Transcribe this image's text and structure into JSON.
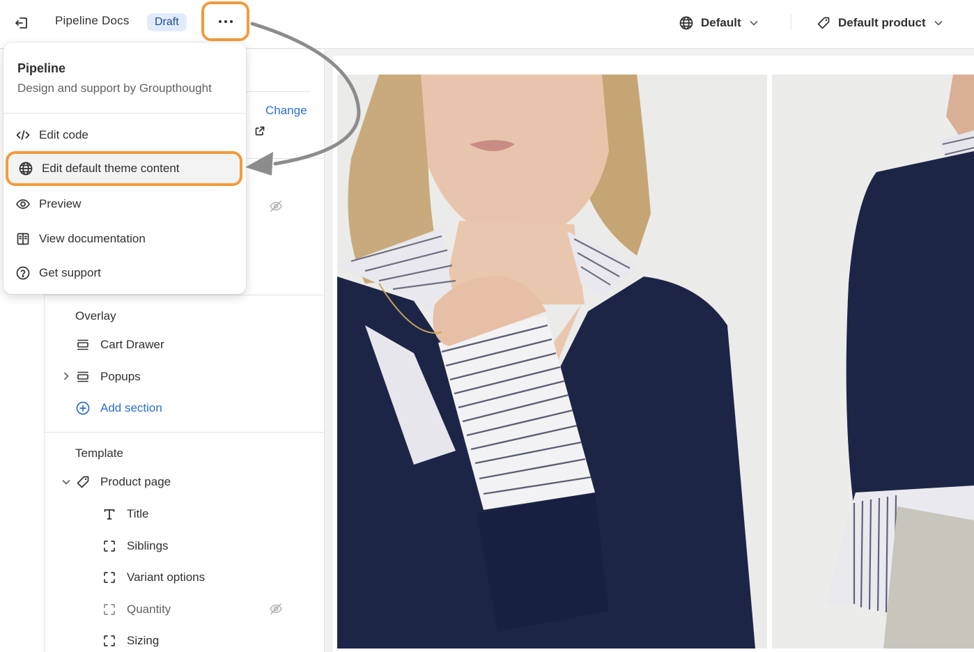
{
  "topbar": {
    "theme_name": "Pipeline Docs",
    "status_badge": "Draft",
    "locale_label": "Default",
    "product_label": "Default product"
  },
  "menu": {
    "title": "Pipeline",
    "subtitle": "Design and support by Groupthought",
    "items": [
      {
        "label": "Edit code",
        "icon": "code-icon"
      },
      {
        "label": "Edit default theme content",
        "icon": "globe-icon"
      },
      {
        "label": "Preview",
        "icon": "eye-icon"
      },
      {
        "label": "View documentation",
        "icon": "book-icon"
      },
      {
        "label": "Get support",
        "icon": "question-circle-icon"
      }
    ]
  },
  "sidebar": {
    "change_label": "Change",
    "overlay": {
      "title": "Overlay",
      "items": [
        {
          "label": "Cart Drawer"
        },
        {
          "label": "Popups"
        }
      ],
      "add_section": "Add section"
    },
    "template": {
      "title": "Template",
      "page": "Product page",
      "blocks": [
        {
          "label": "Title"
        },
        {
          "label": "Siblings"
        },
        {
          "label": "Variant options"
        },
        {
          "label": "Quantity"
        },
        {
          "label": "Sizing"
        }
      ]
    }
  },
  "colors": {
    "highlight": "#f39a3c",
    "link": "#2c6ecb",
    "badge_bg": "#e0ebfb",
    "sweater": "#1d2547"
  }
}
